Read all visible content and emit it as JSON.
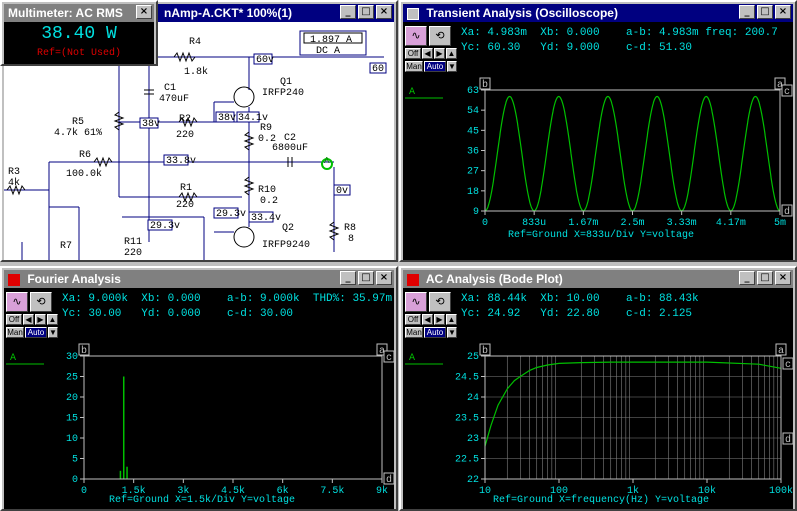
{
  "schematic": {
    "title": "nAmp-A.CKT* 100%(1)",
    "labels": {
      "r4": "R4",
      "r4v": "1.8k",
      "c1": "C1",
      "c1v": "470uF",
      "q1": "Q1",
      "q1v": "IRFP240",
      "r5": "R5",
      "r5v": "4.7k 61%",
      "r2": "R2",
      "r2v": "220",
      "r9": "R9",
      "r9v": "0.2",
      "c2": "C2",
      "c2v": "6800uF",
      "r3": "R3",
      "r3v": "4k",
      "r6": "R6",
      "r6v": "100.0k",
      "r1": "R1",
      "r1v": "220",
      "r10": "R10",
      "r10v": "0.2",
      "r8": "R8",
      "r8v": "8",
      "r7": "R7",
      "r11": "R11",
      "r11v": "220",
      "q2": "Q2",
      "q2v": "IRFP9240",
      "node_a": "A"
    },
    "nodes": [
      "60v",
      "38v",
      "38v",
      "34.1v",
      "33.8v",
      "0v",
      "29.3v",
      "29.3v",
      "33.4v",
      "60"
    ],
    "ammeter": {
      "value": "1.897 A",
      "mode": "DC A"
    }
  },
  "multimeter": {
    "title": "Multimeter: AC RMS",
    "value": "38.40 W",
    "ref": "Ref=(Not Used)"
  },
  "transient": {
    "title": "Transient Analysis (Oscilloscope)",
    "cursor_line1": "Xa: 4.983m  Xb: 0.000    a-b: 4.983m freq: 200.7",
    "cursor_line2": "Yc: 60.30   Yd: 9.000    c-d: 51.30",
    "footer": "Ref=Ground  X=833u/Div Y=voltage",
    "trace_label": "A",
    "cursor_a": "a",
    "cursor_b": "b",
    "cursor_c": "c",
    "cursor_d": "d"
  },
  "fourier": {
    "title": "Fourier Analysis",
    "cursor_line1": "Xa: 9.000k  Xb: 0.000    a-b: 9.000k  THD%: 35.97m",
    "cursor_line2": "Yc: 30.00   Yd: 0.000    c-d: 30.00",
    "footer": "Ref=Ground  X=1.5k/Div Y=voltage",
    "trace_label": "A",
    "cursor_a": "a",
    "cursor_b": "b",
    "cursor_c": "c",
    "cursor_d": "d"
  },
  "bode": {
    "title": "AC Analysis (Bode Plot)",
    "cursor_line1": "Xa: 88.44k  Xb: 10.00    a-b: 88.43k",
    "cursor_line2": "Yc: 24.92   Yd: 22.80    c-d: 2.125",
    "footer": "Ref=Ground  X=frequency(Hz) Y=voltage",
    "trace_label": "A",
    "cursor_a": "a",
    "cursor_b": "b",
    "cursor_c": "c",
    "cursor_d": "d"
  },
  "toolbar": {
    "off": "Off",
    "man": "Man",
    "auto": "Auto"
  },
  "window_buttons": {
    "min": "_",
    "max": "□",
    "close": "×"
  },
  "chart_data": [
    {
      "type": "line",
      "title": "Transient Analysis (Oscilloscope)",
      "xlabel": "",
      "ylabel": "voltage",
      "x_ticks": [
        "0",
        "833u",
        "1.67m",
        "2.5m",
        "3.33m",
        "4.17m",
        "5m"
      ],
      "y_ticks": [
        "63",
        "54",
        "45",
        "36",
        "27",
        "18",
        "9"
      ],
      "xlim": [
        0,
        0.005
      ],
      "ylim": [
        9,
        63
      ],
      "series": [
        {
          "name": "A",
          "frequency_hz": 1200,
          "offset": 34.6,
          "amplitude": 25.5,
          "color": "#00c000"
        }
      ]
    },
    {
      "type": "bar",
      "title": "Fourier Analysis",
      "ylabel": "voltage",
      "x_ticks": [
        "0",
        "1.5k",
        "3k",
        "4.5k",
        "6k",
        "7.5k",
        "9k"
      ],
      "y_ticks": [
        "30",
        "25",
        "20",
        "15",
        "10",
        "5",
        "0"
      ],
      "xlim": [
        0,
        9000
      ],
      "ylim": [
        0,
        30
      ],
      "series": [
        {
          "name": "A",
          "x": [
            1100,
            1200,
            1300
          ],
          "values": [
            2,
            25,
            3
          ],
          "color": "#00c000"
        }
      ]
    },
    {
      "type": "line",
      "title": "AC Analysis (Bode Plot)",
      "xlabel": "frequency(Hz)",
      "ylabel": "voltage",
      "x_ticks": [
        "10",
        "100",
        "1k",
        "10k",
        "100k"
      ],
      "y_ticks": [
        "25",
        "24.5",
        "24",
        "23.5",
        "23",
        "22.5",
        "22"
      ],
      "log_x": true,
      "xlim": [
        10,
        100000
      ],
      "ylim": [
        22,
        25
      ],
      "series": [
        {
          "name": "A",
          "x": [
            10,
            12,
            15,
            20,
            25,
            30,
            40,
            50,
            70,
            100,
            200,
            500,
            1000,
            10000,
            50000,
            100000
          ],
          "values": [
            22.8,
            23.3,
            23.8,
            24.2,
            24.4,
            24.5,
            24.65,
            24.72,
            24.78,
            24.82,
            24.84,
            24.85,
            24.85,
            24.85,
            24.8,
            24.7
          ],
          "color": "#00c000"
        }
      ]
    }
  ]
}
